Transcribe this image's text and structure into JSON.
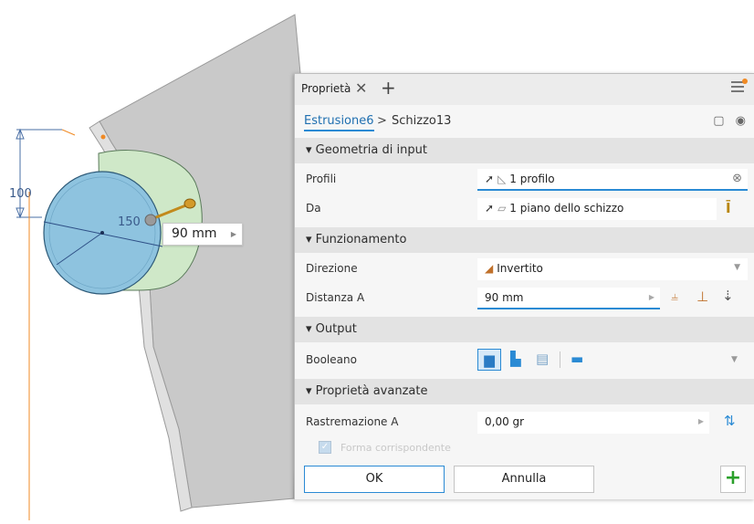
{
  "viewport": {
    "dim_vertical": "100",
    "dim_diameter": "150",
    "dim_input_value": "90 mm"
  },
  "panel": {
    "tab_title": "Proprietà",
    "breadcrumb": {
      "feature": "Estrusione6",
      "separator": ">",
      "sketch": "Schizzo13"
    },
    "sections": {
      "input_geometry": "Geometria di input",
      "behavior": "Funzionamento",
      "output": "Output",
      "advanced": "Proprietà avanzate"
    },
    "rows": {
      "profiles": {
        "label": "Profili",
        "value": "1 profilo"
      },
      "from": {
        "label": "Da",
        "value": "1 piano dello schizzo"
      },
      "direction": {
        "label": "Direzione",
        "value": "Invertito"
      },
      "distance_a": {
        "label": "Distanza A",
        "value": "90 mm"
      },
      "boolean": {
        "label": "Booleano"
      },
      "taper_a": {
        "label": "Rastremazione A",
        "value": "0,00 gr"
      },
      "match_shape": {
        "label": "Forma corrispondente",
        "checked": true,
        "enabled": false
      }
    },
    "buttons": {
      "ok": "OK",
      "cancel": "Annulla"
    }
  },
  "colors": {
    "accent": "#2a8ad4",
    "section_bg": "#e3e3e3",
    "panel_bg": "#f6f6f6",
    "add_green": "#2aa02a"
  }
}
